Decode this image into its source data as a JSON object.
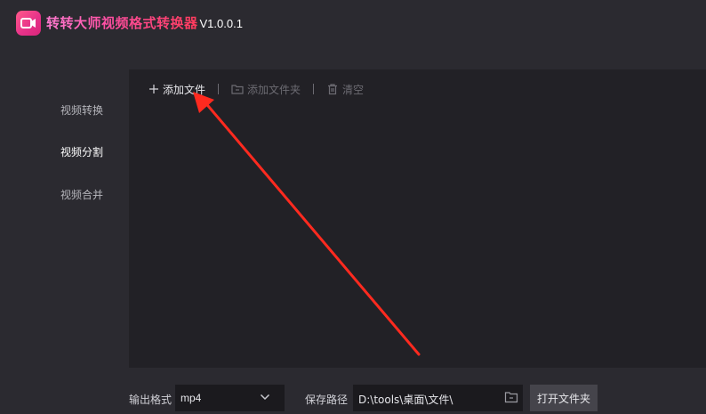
{
  "app": {
    "name": "转转大师视频格式转换器",
    "version": "V1.0.0.1",
    "logo_icon": "video-camera-icon",
    "brand_color": "#ff4fa3"
  },
  "sidebar": {
    "items": [
      {
        "label": "视频转换",
        "active": false
      },
      {
        "label": "视频分割",
        "active": true
      },
      {
        "label": "视频合并",
        "active": false
      }
    ]
  },
  "toolbar": {
    "add_file": "添加文件",
    "add_folder": "添加文件夹",
    "clear": "清空"
  },
  "bottom": {
    "format_label": "输出格式",
    "format_value": "mp4",
    "path_label": "保存路径",
    "path_value": "D:\\tools\\桌面\\文件\\",
    "open_folder": "打开文件夹"
  },
  "annotation": {
    "color": "#ff2a1f",
    "icon": "red-arrow-pointing-to-add-file"
  }
}
